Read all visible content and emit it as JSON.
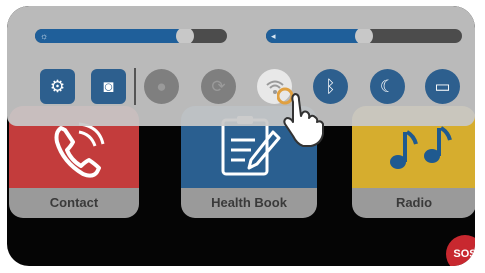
{
  "apps": [
    {
      "label": "Contact",
      "icon": "phone-icon"
    },
    {
      "label": "Health Book",
      "icon": "health-book-icon"
    },
    {
      "label": "Radio",
      "icon": "music-notes-icon"
    }
  ],
  "sos": {
    "label": "SOS"
  },
  "control_center": {
    "brightness": {
      "icon": "sun-icon",
      "level": 0.78
    },
    "volume": {
      "icon": "volume-icon",
      "level": 0.5
    },
    "buttons": [
      {
        "name": "settings",
        "icon": "gear-icon",
        "state": "active",
        "glyph": "⚙"
      },
      {
        "name": "camera",
        "icon": "camera-icon",
        "state": "active",
        "glyph": "◙"
      },
      {
        "name": "flashlight",
        "icon": "flashlight-icon",
        "state": "off",
        "glyph": "●"
      },
      {
        "name": "rotation",
        "icon": "rotation-icon",
        "state": "off",
        "glyph": "⟳"
      },
      {
        "name": "wifi",
        "icon": "wifi-icon",
        "state": "pressed",
        "glyph": "◉"
      },
      {
        "name": "bluetooth",
        "icon": "bluetooth-icon",
        "state": "active",
        "glyph": "ᛒ"
      },
      {
        "name": "do-not-disturb",
        "icon": "moon-icon",
        "state": "active",
        "glyph": "☾"
      },
      {
        "name": "reading-mode",
        "icon": "book-icon",
        "state": "active",
        "glyph": "▭"
      }
    ]
  },
  "colors": {
    "contact": "#c33c3c",
    "health_book": "#2a5f90",
    "radio": "#d6ad2e",
    "accent": "#2d5f8e",
    "sos": "#c8282f"
  }
}
